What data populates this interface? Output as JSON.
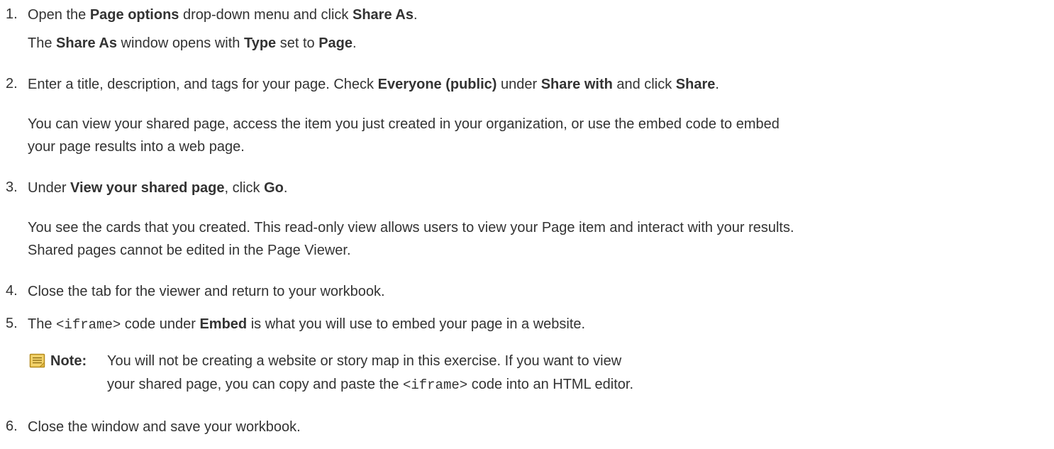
{
  "steps": [
    {
      "number": "1.",
      "parts": {
        "p1": "Open the ",
        "b1": "Page options",
        "p2": " drop-down menu and click ",
        "b2": "Share As",
        "p3": "."
      },
      "sub": {
        "p1": "The ",
        "b1": "Share As",
        "p2": " window opens with ",
        "b2": "Type",
        "p3": " set to ",
        "b3": "Page",
        "p4": "."
      }
    },
    {
      "number": "2.",
      "parts": {
        "p1": "Enter a title, description, and tags for your page. Check ",
        "b1": "Everyone (public)",
        "p2": " under ",
        "b2": "Share with",
        "p3": " and click ",
        "b3": "Share",
        "p4": "."
      },
      "para_line1": "You can view your shared page, access the item you just created in your organization, or use the embed code to embed",
      "para_line2": "your page results into a web page."
    },
    {
      "number": "3.",
      "parts": {
        "p1": "Under ",
        "b1": "View your shared page",
        "p2": ", click ",
        "b2": "Go",
        "p3": "."
      },
      "para_line1": "You see the cards that you created. This read-only view allows users to view your Page item and interact with your results.",
      "para_line2": "Shared pages cannot be edited in the Page Viewer."
    },
    {
      "number": "4.",
      "text": "Close the tab for the viewer and return to your workbook."
    },
    {
      "number": "5.",
      "parts": {
        "p1": "The ",
        "code": "<iframe>",
        "p2": " code under ",
        "b1": "Embed",
        "p3": " is what you will use to embed your page in a website."
      },
      "note": {
        "icon": "note-icon",
        "label": "Note:",
        "line1": "You will not be creating a website or story map in this exercise. If you want to view",
        "line2_p1": "your shared page, you can copy and paste the ",
        "line2_code": "<iframe>",
        "line2_p2": " code into an HTML editor."
      }
    },
    {
      "number": "6.",
      "text": "Close the window and save your workbook."
    }
  ],
  "colors": {
    "text": "#333333",
    "note_icon_fill": "#f3d36b",
    "note_icon_stroke": "#b58a1a"
  }
}
